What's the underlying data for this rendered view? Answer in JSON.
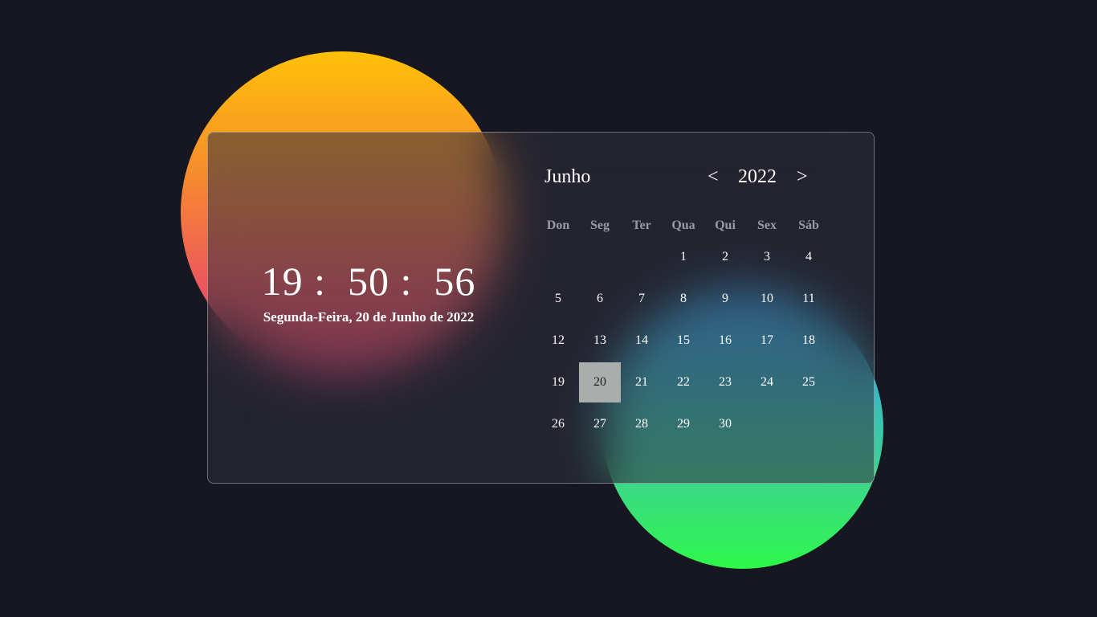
{
  "clock": {
    "time": "19 :  50 :  56",
    "date": "Segunda-Feira, 20 de Junho de 2022"
  },
  "calendar": {
    "month": "Junho",
    "year": "2022",
    "prev_label": "<",
    "next_label": ">",
    "weekdays": [
      "Don",
      "Seg",
      "Ter",
      "Qua",
      "Qui",
      "Sex",
      "Sáb"
    ],
    "weeks": [
      [
        "",
        "",
        "",
        "1",
        "2",
        "3",
        "4"
      ],
      [
        "5",
        "6",
        "7",
        "8",
        "9",
        "10",
        "11"
      ],
      [
        "12",
        "13",
        "14",
        "15",
        "16",
        "17",
        "18"
      ],
      [
        "19",
        "20",
        "21",
        "22",
        "23",
        "24",
        "25"
      ],
      [
        "26",
        "27",
        "28",
        "29",
        "30",
        "",
        ""
      ]
    ],
    "today": "20"
  },
  "colors": {
    "background": "#171722",
    "warm_blob_top": "#ffc107",
    "warm_blob_bottom": "#e03b6c",
    "cool_blob_top": "#2f9ee8",
    "cool_blob_bottom": "#2ef84a",
    "today_highlight": "#a9adab"
  }
}
